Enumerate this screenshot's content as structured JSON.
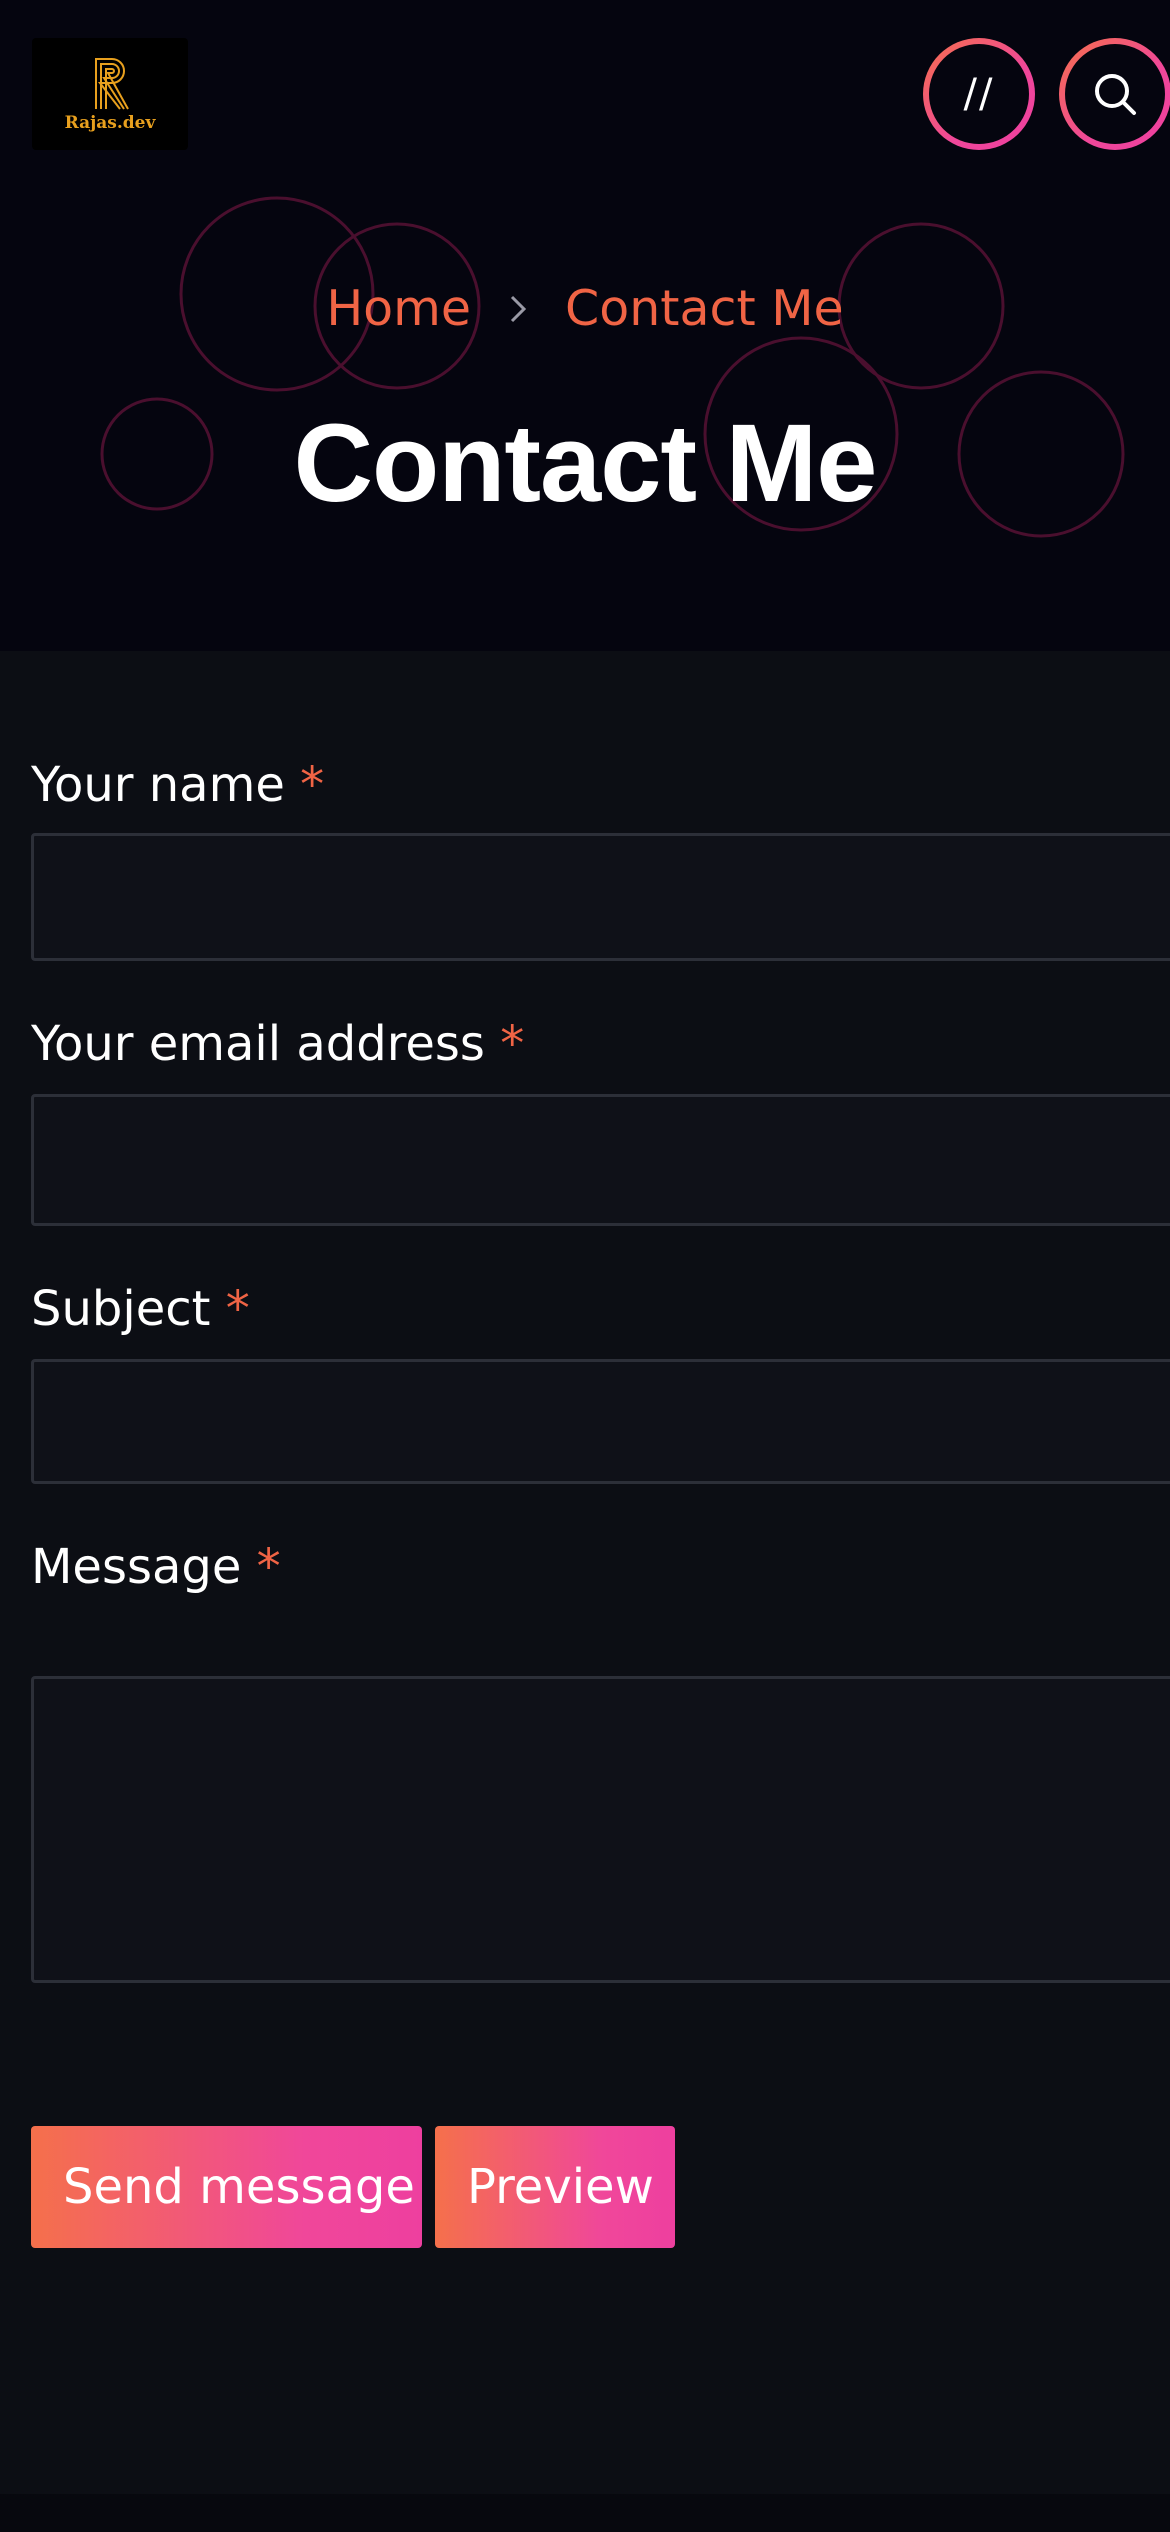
{
  "header": {
    "logo_text": "Rajas.dev",
    "menu_button_label": "//",
    "search_icon": "search-icon"
  },
  "breadcrumb": {
    "home": "Home",
    "separator_icon": "chevron-right-icon",
    "current": "Contact Me"
  },
  "page_title": "Contact Me",
  "form": {
    "name_label": "Your name",
    "email_label": "Your email address",
    "subject_label": "Subject",
    "message_label": "Message",
    "required_marker": "*",
    "send_label": "Send message",
    "preview_label": "Preview"
  },
  "colors": {
    "accent_start": "#f5704b",
    "accent_end": "#ee3f9f",
    "hero_bg": "#05050f",
    "page_bg": "#0c0e14",
    "breadcrumb": "#f06445"
  }
}
